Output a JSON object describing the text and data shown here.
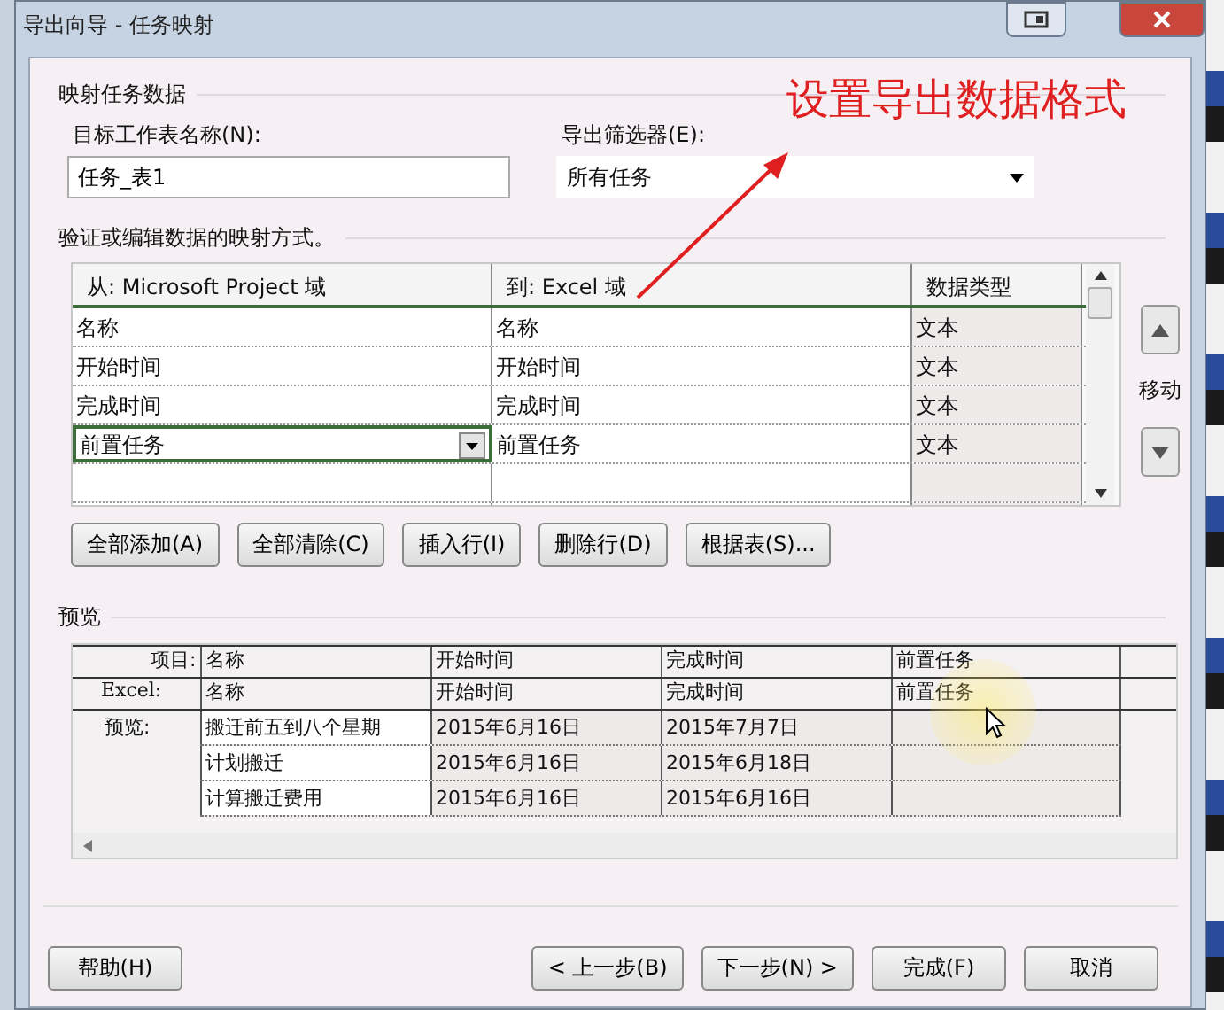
{
  "window": {
    "title": "导出向导 - 任务映射"
  },
  "annotation": {
    "text": "设置导出数据格式"
  },
  "section_title": "映射任务数据",
  "sheet_name": {
    "label": "目标工作表名称(N):",
    "value": "任务_表1"
  },
  "filter": {
    "label": "导出筛选器(E):",
    "value": "所有任务"
  },
  "mapping_hint": "验证或编辑数据的映射方式。",
  "mapping": {
    "columns": [
      "从: Microsoft Project 域",
      "到: Excel 域",
      "数据类型"
    ],
    "rows": [
      {
        "from": "名称",
        "to": "名称",
        "type": "文本",
        "editing": false
      },
      {
        "from": "开始时间",
        "to": "开始时间",
        "type": "文本",
        "editing": false
      },
      {
        "from": "完成时间",
        "to": "完成时间",
        "type": "文本",
        "editing": false
      },
      {
        "from": "前置任务",
        "to": "前置任务",
        "type": "文本",
        "editing": true
      }
    ]
  },
  "move_label": "移动",
  "mapping_buttons": [
    "全部添加(A)",
    "全部清除(C)",
    "插入行(I)",
    "删除行(D)",
    "根据表(S)..."
  ],
  "preview": {
    "title": "预览",
    "header_rows": [
      {
        "label": "项目:",
        "cells": [
          "名称",
          "开始时间",
          "完成时间",
          "前置任务"
        ]
      },
      {
        "label": "Excel:",
        "cells": [
          "名称",
          "开始时间",
          "完成时间",
          "前置任务"
        ]
      }
    ],
    "preview_label": "预览:",
    "rows": [
      [
        "搬迁前五到八个星期",
        "2015年6月16日",
        "2015年7月7日"
      ],
      [
        "计划搬迁",
        "2015年6月16日",
        "2015年6月18日"
      ],
      [
        "计算搬迁费用",
        "2015年6月16日",
        "2015年6月16日"
      ]
    ]
  },
  "help_button": "帮助(H)",
  "nav_buttons": [
    "< 上一步(B)",
    "下一步(N) >",
    "完成(F)",
    "取消"
  ]
}
